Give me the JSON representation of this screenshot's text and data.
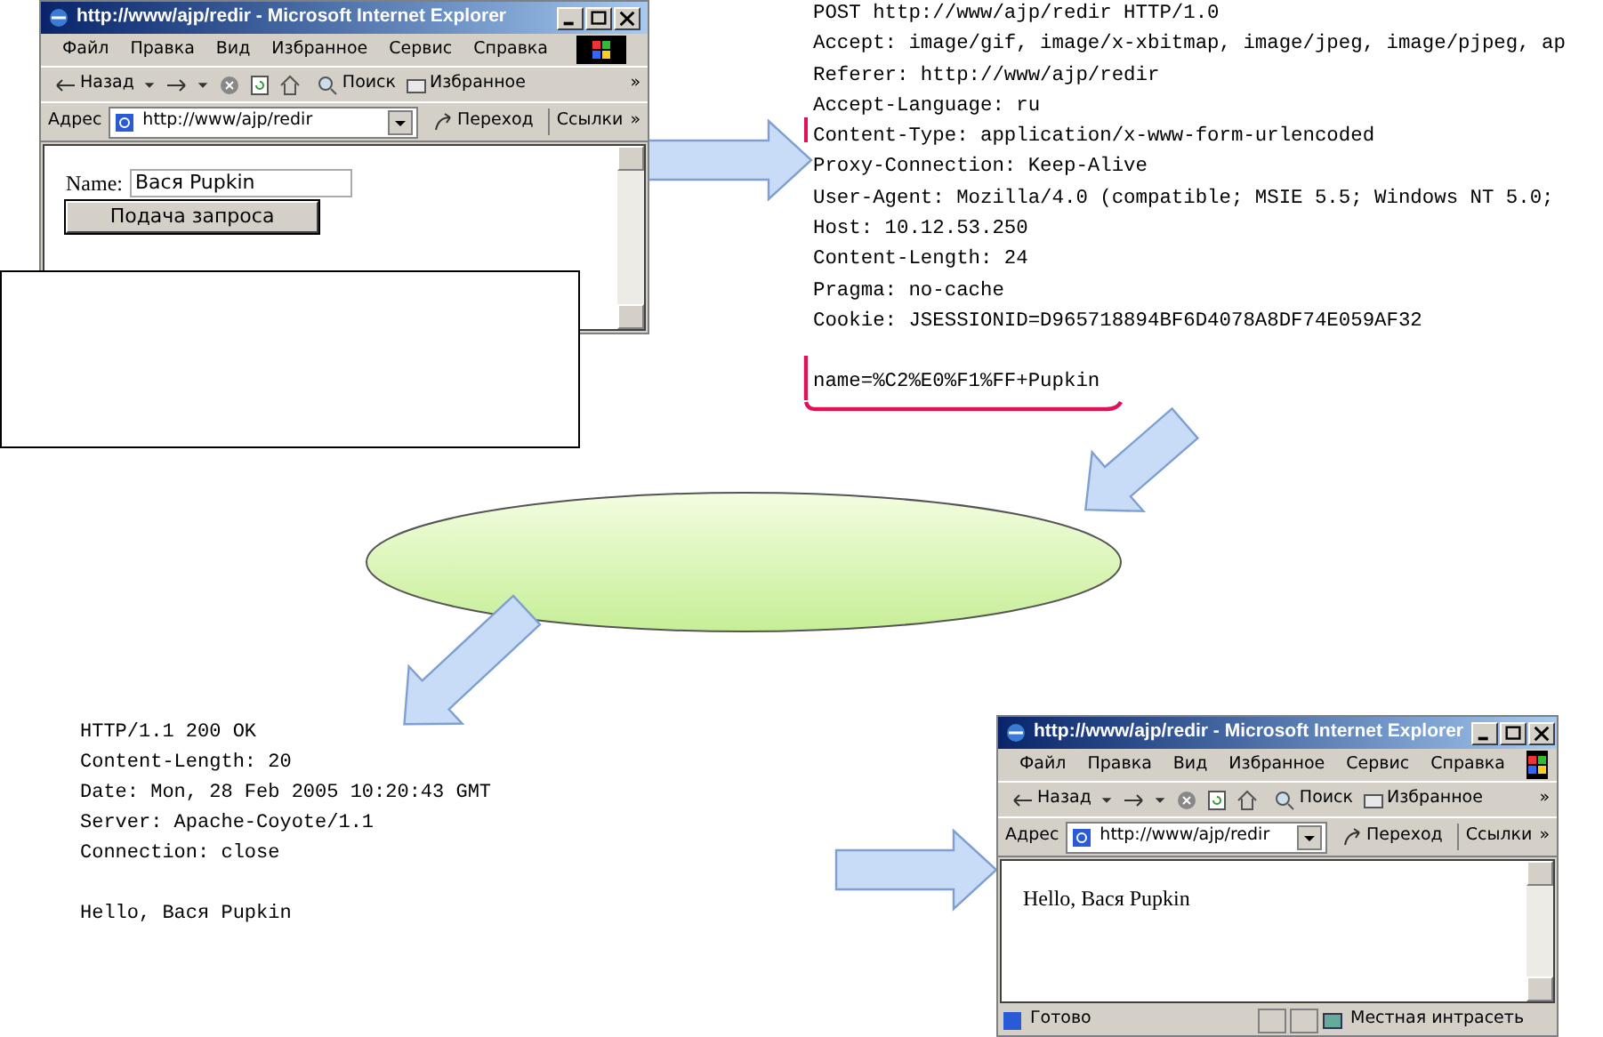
{
  "request_window": {
    "title": "http://www/ajp/redir - Microsoft Internet Explorer",
    "menu": [
      "Файл",
      "Правка",
      "Вид",
      "Избранное",
      "Сервис",
      "Справка"
    ],
    "back": "Назад",
    "search": "Поиск",
    "favorites": "Избранное",
    "toolbar_more": "»",
    "address_label": "Адрес",
    "url": "http://www/ajp/redir",
    "go": "Переход",
    "links": "Ссылки",
    "links_more": "»",
    "form": {
      "label": "Name:",
      "value": "Вася Pupkin",
      "submit": "Подача запроса"
    }
  },
  "http_request": {
    "lines": [
      "POST http://www/ajp/redir HTTP/1.0",
      "Accept: image/gif, image/x-xbitmap, image/jpeg, image/pjpeg, ap",
      "Referer: http://www/ajp/redir",
      "Accept-Language: ru",
      "Content-Type: application/x-www-form-urlencoded",
      "Proxy-Connection: Keep-Alive",
      "User-Agent: Mozilla/4.0 (compatible; MSIE 5.5; Windows NT 5.0;",
      "Host: 10.12.53.250",
      "Content-Length: 24",
      "Pragma: no-cache",
      "Cookie: JSESSIONID=D965718894BF6D4078A8DF74E059AF32"
    ],
    "body": "name=%C2%E0%F1%FF+Pupkin"
  },
  "http_response": {
    "lines": [
      "HTTP/1.1 200 OK",
      "Content-Length: 20",
      "Date: Mon, 28 Feb 2005 10:20:43 GMT",
      "Server: Apache-Coyote/1.1",
      "Connection: close"
    ],
    "body": "Hello, Вася Pupkin"
  },
  "response_window": {
    "title": "http://www/ajp/redir - Microsoft Internet Explorer",
    "menu": [
      "Файл",
      "Правка",
      "Вид",
      "Избранное",
      "Сервис",
      "Справка"
    ],
    "back": "Назад",
    "search": "Поиск",
    "favorites": "Избранное",
    "toolbar_more": "»",
    "address_label": "Адрес",
    "url": "http://www/ajp/redir",
    "go": "Переход",
    "links": "Ссылки",
    "links_more": "»",
    "content": "Hello, Вася Pupkin",
    "status": "Готово",
    "zone": "Местная интрасеть"
  }
}
